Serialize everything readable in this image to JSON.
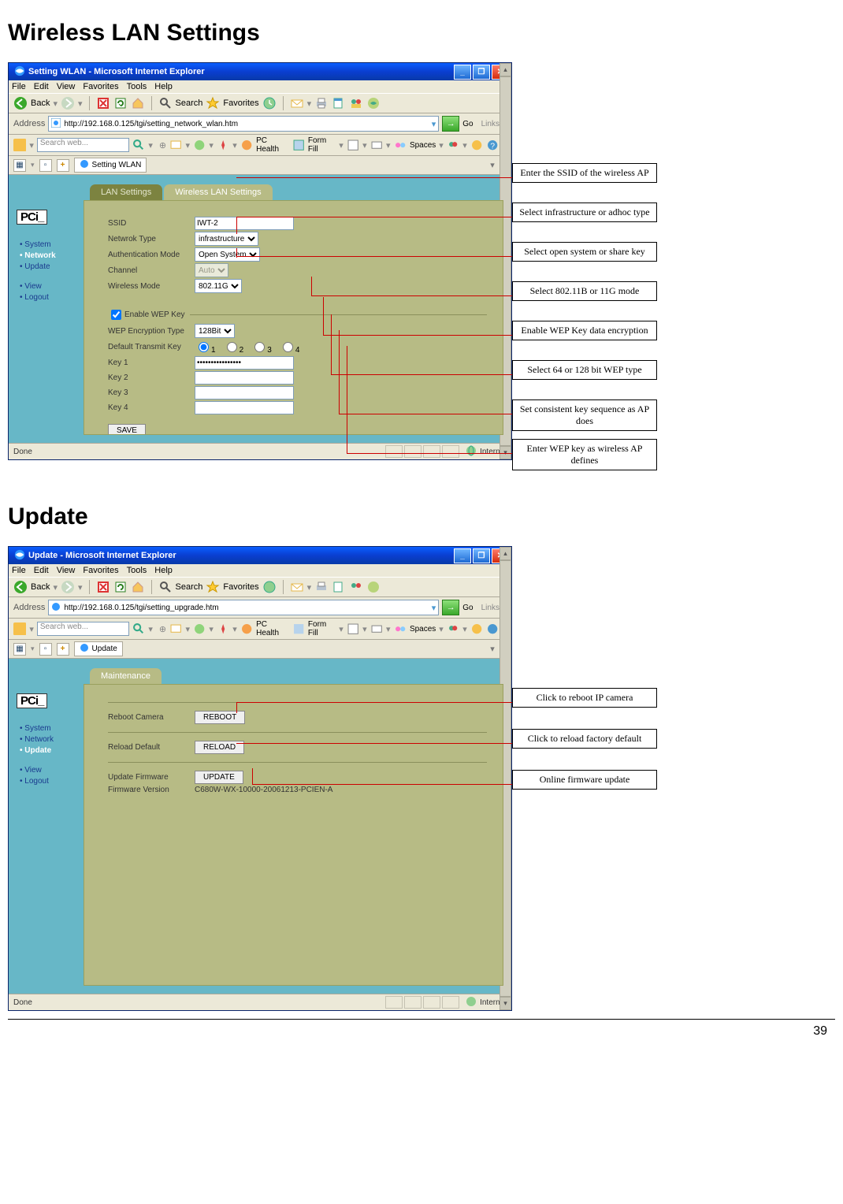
{
  "page_number": "39",
  "section1_title": "Wireless LAN Settings",
  "section2_title": "Update",
  "ie_menus": [
    "File",
    "Edit",
    "View",
    "Favorites",
    "Tools",
    "Help"
  ],
  "toolbar_labels": {
    "back": "Back",
    "search": "Search",
    "favorites": "Favorites"
  },
  "address_label": "Address",
  "go_label": "Go",
  "links_label": "Links",
  "searchbox_placeholder": "Search web...",
  "searchbar_items": [
    "PC Health",
    "Form Fill",
    "Spaces"
  ],
  "status_done": "Done",
  "status_internet": "Internet",
  "win1": {
    "title": "Setting WLAN - Microsoft Internet Explorer",
    "tab_title": "Setting WLAN",
    "address": "http://192.168.0.125/tgi/setting_network_wlan.htm",
    "sidebar": [
      {
        "label": "System",
        "active": false
      },
      {
        "label": "Network",
        "active": true
      },
      {
        "label": "Update",
        "active": false
      },
      {
        "label": "View",
        "active": false
      },
      {
        "label": "Logout",
        "active": false
      }
    ],
    "tabs": [
      {
        "label": "LAN Settings",
        "active": false
      },
      {
        "label": "Wireless LAN Settings",
        "active": true
      }
    ],
    "form": {
      "ssid_label": "SSID",
      "ssid_value": "IWT-2",
      "nettype_label": "Netwrok Type",
      "nettype_value": "infrastructure",
      "auth_label": "Authentication Mode",
      "auth_value": "Open System",
      "channel_label": "Channel",
      "channel_value": "Auto",
      "wmode_label": "Wireless Mode",
      "wmode_value": "802.11G",
      "enablewep_label": "Enable WEP Key",
      "weptype_label": "WEP Encryption Type",
      "weptype_value": "128Bit",
      "deftx_label": "Default Transmit Key",
      "deftx_options": [
        "1",
        "2",
        "3",
        "4"
      ],
      "key1_label": "Key 1",
      "key1_value": "••••••••••••••••",
      "key2_label": "Key 2",
      "key2_value": "",
      "key3_label": "Key 3",
      "key3_value": "",
      "key4_label": "Key 4",
      "key4_value": "",
      "save_label": "SAVE"
    },
    "callouts": [
      "Enter the SSID of the wireless AP",
      "Select infrastructure or adhoc type",
      "Select open system or share key",
      "Select 802.11B or 11G mode",
      "Enable WEP Key data encryption",
      "Select 64 or 128 bit WEP type",
      "Set consistent key sequence as AP does",
      "Enter WEP key as wireless AP defines"
    ]
  },
  "win2": {
    "title": "Update - Microsoft Internet Explorer",
    "tab_title": "Update",
    "address": "http://192.168.0.125/tgi/setting_upgrade.htm",
    "sidebar": [
      {
        "label": "System",
        "active": false
      },
      {
        "label": "Network",
        "active": false
      },
      {
        "label": "Update",
        "active": true
      },
      {
        "label": "View",
        "active": false
      },
      {
        "label": "Logout",
        "active": false
      }
    ],
    "tab_label": "Maintenance",
    "form": {
      "reboot_label": "Reboot Camera",
      "reboot_btn": "REBOOT",
      "reload_label": "Reload Default",
      "reload_btn": "RELOAD",
      "update_label": "Update Firmware",
      "update_btn": "UPDATE",
      "fwver_label": "Firmware Version",
      "fwver_value": "C680W-WX-10000-20061213-PCIEN-A"
    },
    "callouts": [
      "Click to reboot IP camera",
      "Click to reload factory default",
      "Online firmware update"
    ]
  },
  "logo_text": "PCi_"
}
